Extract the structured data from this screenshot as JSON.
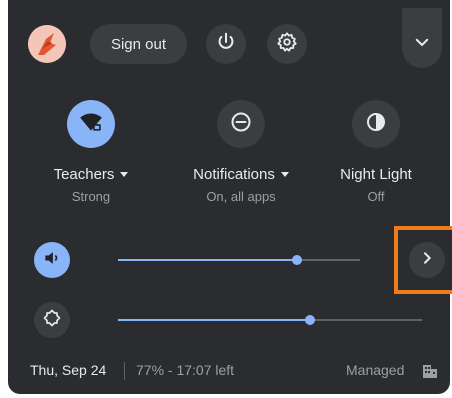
{
  "header": {
    "sign_out_label": "Sign out"
  },
  "features": [
    {
      "label": "Teachers",
      "sublabel": "Strong",
      "has_dropdown": true,
      "active": true,
      "icon": "wifi-icon"
    },
    {
      "label": "Notifications",
      "sublabel": "On, all apps",
      "has_dropdown": true,
      "active": false,
      "icon": "do-not-disturb-icon"
    },
    {
      "label": "Night Light",
      "sublabel": "Off",
      "has_dropdown": false,
      "active": false,
      "icon": "night-light-icon"
    }
  ],
  "sliders": {
    "volume_level": 0.74,
    "brightness_level": 0.63
  },
  "footer": {
    "date": "Thu, Sep 24",
    "battery": "77% - 17:07 left",
    "managed": "Managed"
  },
  "colors": {
    "panel": "#2b2c2f",
    "accent": "#8ab4f8",
    "highlight_box": "#f07b1c"
  }
}
